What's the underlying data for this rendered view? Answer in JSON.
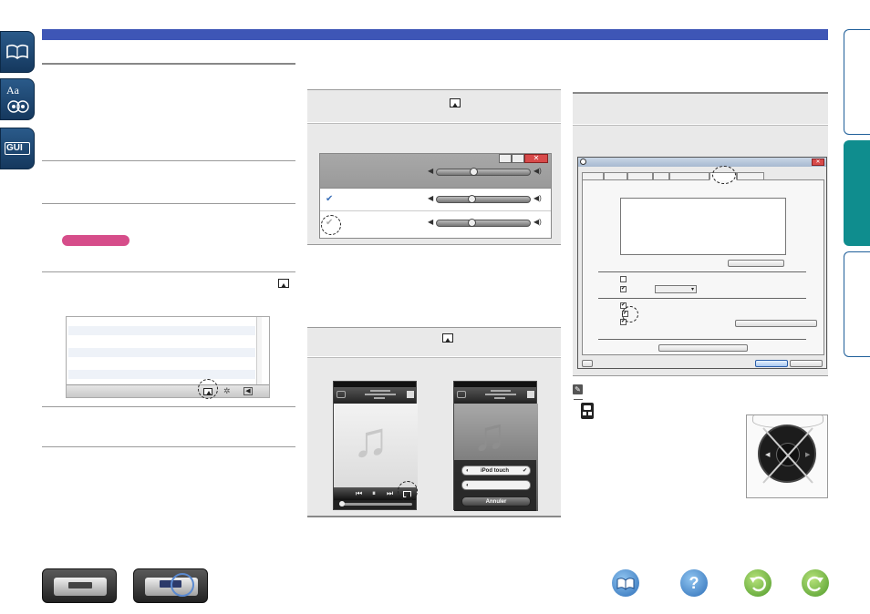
{
  "page": {
    "nav_left": [
      {
        "name": "contents-tab",
        "icon": "open-book-icon"
      },
      {
        "name": "index-tab",
        "icon": "glossary-icon",
        "label": "Aa"
      },
      {
        "name": "gui-tab",
        "icon": "gui-icon",
        "label": "GUI"
      }
    ],
    "dialog": {
      "ok_label": "",
      "cancel_label": ""
    },
    "phone2": {
      "row1_label": "iPod touch",
      "cancel_label": "Annuler"
    },
    "bottom_nav": [
      {
        "name": "front-panel-button",
        "icon": "front-panel-icon"
      },
      {
        "name": "remote-panel-button",
        "icon": "rear-panel-icon"
      },
      {
        "name": "manual-button",
        "icon": "book-icon"
      },
      {
        "name": "help-button",
        "icon": "question-icon",
        "label": "?"
      },
      {
        "name": "back-button",
        "icon": "back-arrow-icon"
      },
      {
        "name": "forward-button",
        "icon": "forward-arrow-icon"
      }
    ],
    "colors": {
      "header_bar": "#3e56b6",
      "accent_teal": "#0f8d8e",
      "pink": "#d64d8a",
      "nav_blue": "#1f4f80",
      "green_button": "#5aa83a",
      "blue_button": "#3a7fd0"
    }
  }
}
